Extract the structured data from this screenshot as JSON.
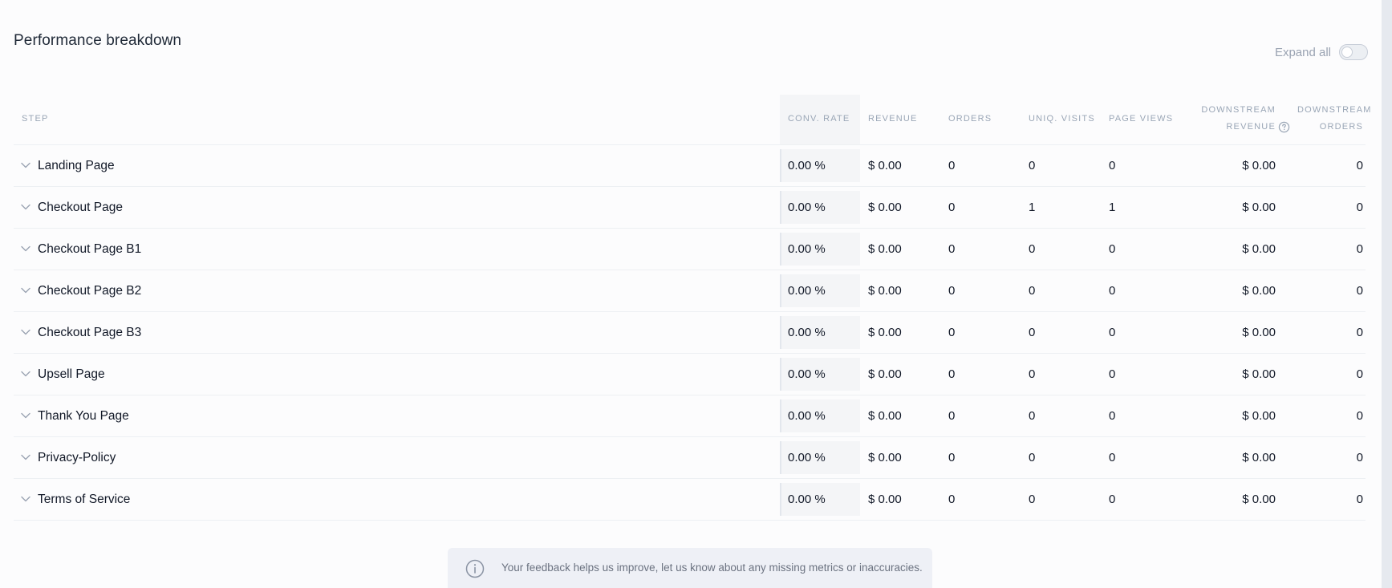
{
  "title": "Performance breakdown",
  "expand_all": {
    "label": "Expand all",
    "enabled": false
  },
  "table": {
    "headers": {
      "step": "STEP",
      "conv_rate": "CONV. RATE",
      "revenue": "REVENUE",
      "orders": "ORDERS",
      "uniq_visits": "UNIQ. VISITS",
      "page_views": "PAGE VIEWS",
      "downstream_revenue_1": "DOWNSTREAM",
      "downstream_revenue_2": "REVENUE",
      "downstream_orders_1": "DOWNSTREAM",
      "downstream_orders_2": "ORDERS"
    },
    "rows": [
      {
        "step": "Landing Page",
        "conv_rate": "0.00 %",
        "revenue": "$ 0.00",
        "orders": "0",
        "uniq_visits": "0",
        "page_views": "0",
        "downstream_revenue": "$ 0.00",
        "downstream_orders": "0"
      },
      {
        "step": "Checkout Page",
        "conv_rate": "0.00 %",
        "revenue": "$ 0.00",
        "orders": "0",
        "uniq_visits": "1",
        "page_views": "1",
        "downstream_revenue": "$ 0.00",
        "downstream_orders": "0"
      },
      {
        "step": "Checkout Page B1",
        "conv_rate": "0.00 %",
        "revenue": "$ 0.00",
        "orders": "0",
        "uniq_visits": "0",
        "page_views": "0",
        "downstream_revenue": "$ 0.00",
        "downstream_orders": "0"
      },
      {
        "step": "Checkout Page B2",
        "conv_rate": "0.00 %",
        "revenue": "$ 0.00",
        "orders": "0",
        "uniq_visits": "0",
        "page_views": "0",
        "downstream_revenue": "$ 0.00",
        "downstream_orders": "0"
      },
      {
        "step": "Checkout Page B3",
        "conv_rate": "0.00 %",
        "revenue": "$ 0.00",
        "orders": "0",
        "uniq_visits": "0",
        "page_views": "0",
        "downstream_revenue": "$ 0.00",
        "downstream_orders": "0"
      },
      {
        "step": "Upsell Page",
        "conv_rate": "0.00 %",
        "revenue": "$ 0.00",
        "orders": "0",
        "uniq_visits": "0",
        "page_views": "0",
        "downstream_revenue": "$ 0.00",
        "downstream_orders": "0"
      },
      {
        "step": "Thank You Page",
        "conv_rate": "0.00 %",
        "revenue": "$ 0.00",
        "orders": "0",
        "uniq_visits": "0",
        "page_views": "0",
        "downstream_revenue": "$ 0.00",
        "downstream_orders": "0"
      },
      {
        "step": "Privacy-Policy",
        "conv_rate": "0.00 %",
        "revenue": "$ 0.00",
        "orders": "0",
        "uniq_visits": "0",
        "page_views": "0",
        "downstream_revenue": "$ 0.00",
        "downstream_orders": "0"
      },
      {
        "step": "Terms of Service",
        "conv_rate": "0.00 %",
        "revenue": "$ 0.00",
        "orders": "0",
        "uniq_visits": "0",
        "page_views": "0",
        "downstream_revenue": "$ 0.00",
        "downstream_orders": "0"
      }
    ]
  },
  "feedback": {
    "text": "Your feedback helps us improve, let us know about any missing metrics or inaccuracies.",
    "icon": "info-icon"
  },
  "colors": {
    "accent_muted": "#9aa6b6",
    "conv_column_bg": "#f4f5f7",
    "feedback_bg": "#eef0f6"
  }
}
